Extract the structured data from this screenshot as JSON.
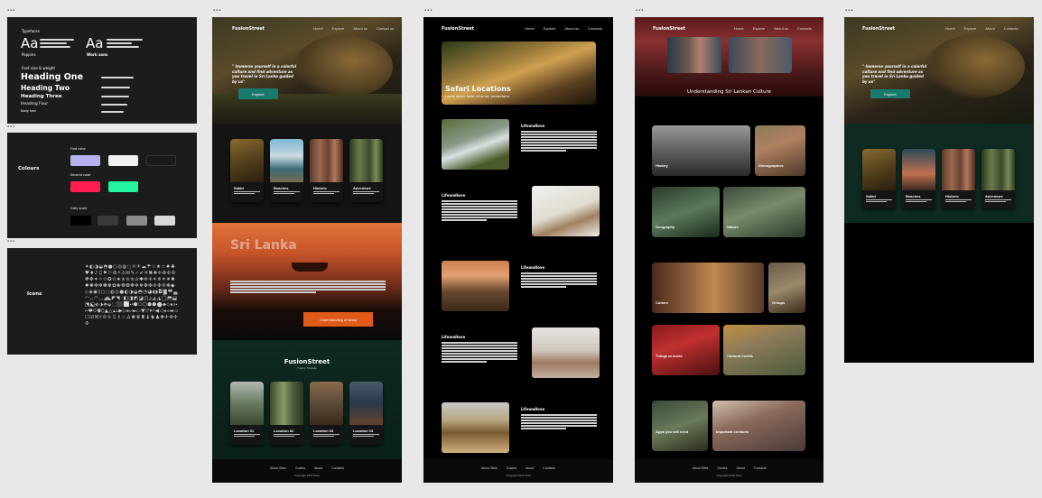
{
  "frame_tag": "▪▪▪",
  "typography": {
    "label": "Typefaces",
    "aa1": "Aa",
    "aa1_name": "Poppins",
    "aa2": "Aa",
    "aa2_name": "Work sans",
    "font_size_label": "Font size & weight",
    "headings": [
      "Heading One",
      "Heading Two",
      "Heading Three",
      "Heading Four",
      "Body text"
    ]
  },
  "colours": {
    "title": "Colours",
    "primary_label": "Find color",
    "secondary_label": "Second color",
    "grey_label": "Grey scale",
    "primary": [
      "#b7b3f0",
      "#f2f2f2",
      "#1a1a1a"
    ],
    "secondary": [
      "#ff1f4f",
      "#23f5a0"
    ],
    "greys": [
      "#000000",
      "#3a3a3a",
      "#8c8c8c",
      "#d9d9d9"
    ]
  },
  "icons": {
    "title": "Icons",
    "glyphs": "✦◐◑◒◓●○◎◍◌☼☀☁☂☃★☆♠♣♥♦♪♫⚑⚐⚙⚡⚠✉✎✓✔✕✖✚✛✜✢✣✤✥✦✧✩✪✫✬✭✮✯✰✱✲✳✴✵✶✷✸✹✺✻✼✽✾✿❀❁❂❃❄❅❆❇❈❉❊❋◆◇◈◉◊○◌◍◎●◐◑◒◓◔◕◖◗◘◙◚◛◜◝◞◟◠◡◢◣◤◥◦◧◨◩◪◫◬◭◮◯⬒⬓⬔⬕⬖⬗⬘⬙⬚⬛⬜⬝⬞⬟⬠⬡⬢⬣⬤⬥⬦⬧⬨⬩⬪⬫⬬⬭⬮⬯▲△▴▵▶▷▸▹►▻▼▽▾▿◀◁◂◃◄◅☐☑☒☓♔♕♖♗♘♙♚♛♜♝♞♟✚✛✜✢✣"
  },
  "home": {
    "logo": "FusionStreet",
    "nav": [
      "Home",
      "Explore",
      "About us",
      "Contact us"
    ],
    "hero_quote": "\" Immerse yourself in a colorful culture and find adventure as you travel in Sri Lanka guided by us\"",
    "hero_button": "Explore",
    "categories": [
      "Safari",
      "Beaches",
      "Historic",
      "Adventure"
    ],
    "banner_title": "Sri Lanka",
    "banner_button": "Understanding of lanka",
    "section_logo": "FusionStreet",
    "section_sub": "Fusion Streets",
    "locations": [
      "Location 01",
      "Location 02",
      "Location 03",
      "Location 04"
    ],
    "footer_nav": [
      "About Sites",
      "Guides",
      "About",
      "Contacts"
    ],
    "copyright": "Copyright 2024 Sites"
  },
  "safari": {
    "logo": "FusionStreet",
    "nav": [
      "Home",
      "Explore",
      "About us",
      "Contacts"
    ],
    "hero_title": "Safari Locations",
    "hero_sub": "Lorem ipsum dolor sit amet, consectetur",
    "sections": [
      "Lifeandlove",
      "Lifeandlove",
      "Lifeandlove",
      "Lifeandlove",
      "Lifeandlove"
    ],
    "footer_nav": [
      "About Sites",
      "Guides",
      "About",
      "Contacts"
    ],
    "copyright": "Copyright 2024 Sites"
  },
  "culture": {
    "logo": "FusionStreet",
    "nav": [
      "Home",
      "Explore",
      "About us",
      "Contacts"
    ],
    "hero_title": "Understanding Sri Lankan Culture",
    "tiles": [
      "History",
      "Demographics",
      "Geography",
      "Nature",
      "Culture",
      "Groups",
      "Things to avoid",
      "Cultural events",
      "Apps you will need",
      "Important contacts"
    ],
    "footer_nav": [
      "About Sites",
      "Guides",
      "About",
      "Contacts"
    ],
    "copyright": "Copyright 2024 Sites"
  },
  "mobile": {
    "logo": "FusionStreet",
    "nav": [
      "Home",
      "Explore",
      "About",
      "Contacts"
    ],
    "hero_quote": "\" Immerse yourself in a colorful culture and find adventure as you travel in Sri Lanka guided by us\"",
    "hero_button": "Explore",
    "categories": [
      "Safari",
      "Beaches",
      "Historic",
      "Adventure"
    ]
  }
}
